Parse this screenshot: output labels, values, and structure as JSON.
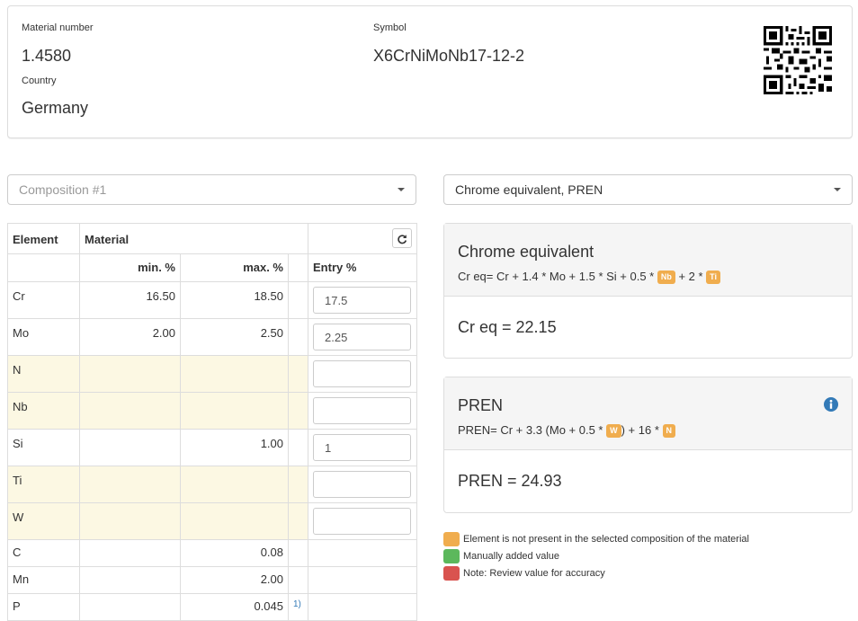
{
  "header": {
    "material_number_label": "Material number",
    "material_number": "1.4580",
    "country_label": "Country",
    "country": "Germany",
    "symbol_label": "Symbol",
    "symbol": "X6CrNiMoNb17-12-2"
  },
  "composition_select": {
    "placeholder": "Composition #1"
  },
  "calc_select": {
    "value": "Chrome equivalent, PREN"
  },
  "table": {
    "col_element": "Element",
    "col_material": "Material",
    "col_min": "min. %",
    "col_max": "max. %",
    "col_entry": "Entry %",
    "rows": [
      {
        "element": "Cr",
        "min": "16.50",
        "max": "18.50",
        "entry": "17.5"
      },
      {
        "element": "Mo",
        "min": "2.00",
        "max": "2.50",
        "entry": "2.25"
      },
      {
        "element": "N",
        "min": "",
        "max": "",
        "entry": ""
      },
      {
        "element": "Nb",
        "min": "",
        "max": "",
        "entry": ""
      },
      {
        "element": "Si",
        "min": "",
        "max": "1.00",
        "entry": "1"
      },
      {
        "element": "Ti",
        "min": "",
        "max": "",
        "entry": ""
      },
      {
        "element": "W",
        "min": "",
        "max": "",
        "entry": ""
      },
      {
        "element": "C",
        "min": "",
        "max": "0.08"
      },
      {
        "element": "Mn",
        "min": "",
        "max": "2.00"
      },
      {
        "element": "P",
        "min": "",
        "max": "0.045",
        "note": "1)"
      }
    ]
  },
  "chrome_panel": {
    "title": "Chrome equivalent",
    "formula_parts": [
      "Cr eq= Cr + 1.4 * Mo + 1.5 * Si + 0.5 * ",
      "Nb",
      " + 2 * ",
      "Ti"
    ],
    "result": "Cr eq = 22.15"
  },
  "pren_panel": {
    "title": "PREN",
    "formula_parts": [
      "PREN= Cr + 3.3 (Mo + 0.5 * ",
      "W",
      ") + 16 * ",
      "N"
    ],
    "result": "PREN = 24.93"
  },
  "legend": [
    {
      "color": "#f0ad4e",
      "text": "Element is not present in the selected composition of the material"
    },
    {
      "color": "#5cb85c",
      "text": "Manually added value"
    },
    {
      "color": "#d9534f",
      "text": "Note: Review value for accuracy"
    }
  ],
  "colors": {
    "missing_row": "#fcf8e3",
    "badge": "#f0ad4e",
    "info": "#337ab7"
  },
  "icons": [
    "qr-code-icon",
    "refresh-icon",
    "info-icon",
    "chevron-down-icon"
  ]
}
